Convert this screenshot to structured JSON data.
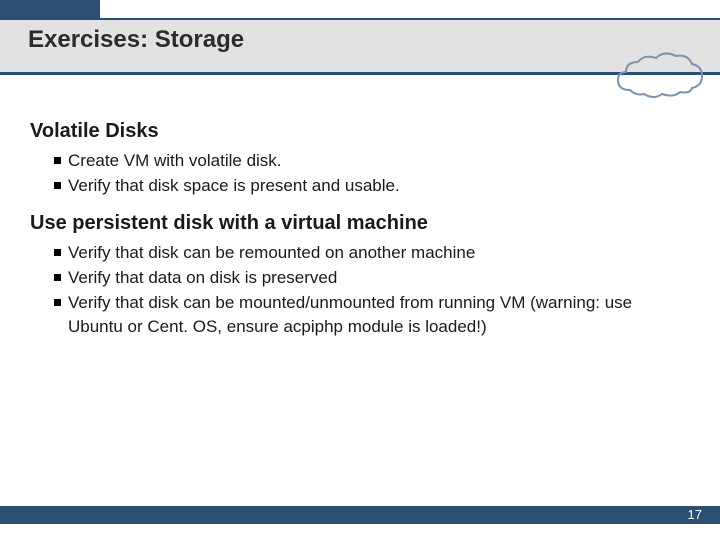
{
  "slide": {
    "title": "Exercises: Storage",
    "page_number": "17"
  },
  "sections": [
    {
      "heading": "Volatile Disks",
      "bullets": [
        "Create VM with volatile disk.",
        "Verify that disk space is present and usable."
      ]
    },
    {
      "heading": "Use persistent disk with a virtual machine",
      "bullets": [
        "Verify that disk can be remounted on another machine",
        "Verify that data on disk is preserved",
        "Verify that disk can be mounted/unmounted from running VM (warning: use Ubuntu or Cent. OS, ensure acpiphp module is loaded!)"
      ]
    }
  ]
}
